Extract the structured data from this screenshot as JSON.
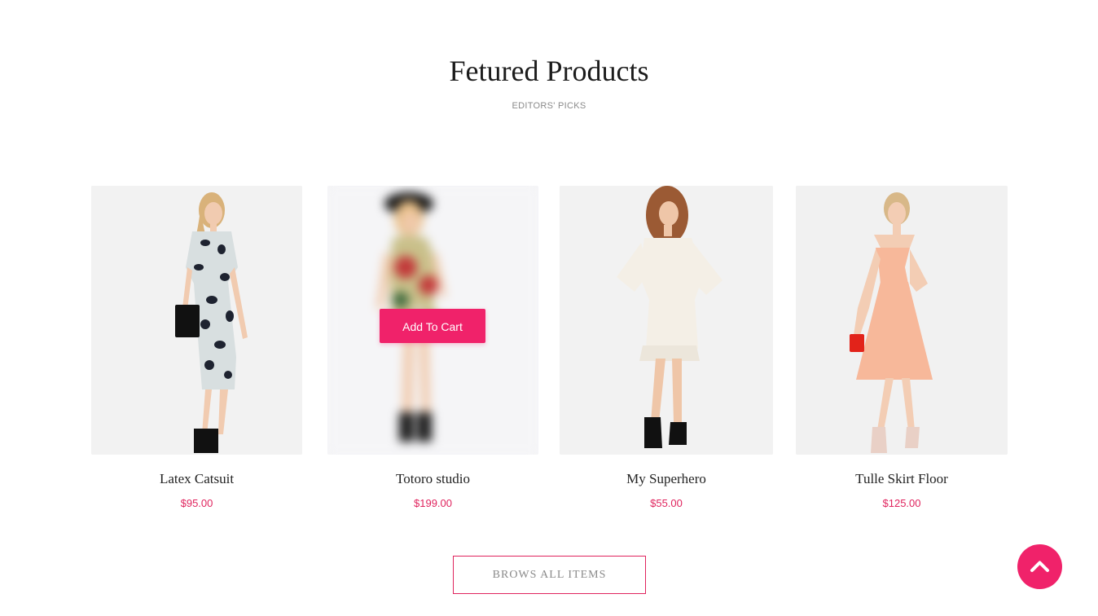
{
  "section": {
    "title": "Fetured Products",
    "subtitle": "EDITORS' PICKS"
  },
  "products": [
    {
      "name": "Latex Catsuit",
      "price": "$95.00",
      "image_icon": "product-image-floral-dress"
    },
    {
      "name": "Totoro studio",
      "price": "$199.00",
      "image_icon": "product-image-rose-dress",
      "hover_action": "Add To Cart"
    },
    {
      "name": "My Superhero",
      "price": "$55.00",
      "image_icon": "product-image-white-dress"
    },
    {
      "name": "Tulle Skirt Floor",
      "price": "$125.00",
      "image_icon": "product-image-peach-dress"
    }
  ],
  "browse_button": "BROWS ALL ITEMS",
  "scroll_top_icon": "chevron-up-icon",
  "colors": {
    "accent": "#f0226a",
    "price": "#e0245e",
    "title": "#1c1c1c",
    "muted": "#8a8a8a"
  }
}
